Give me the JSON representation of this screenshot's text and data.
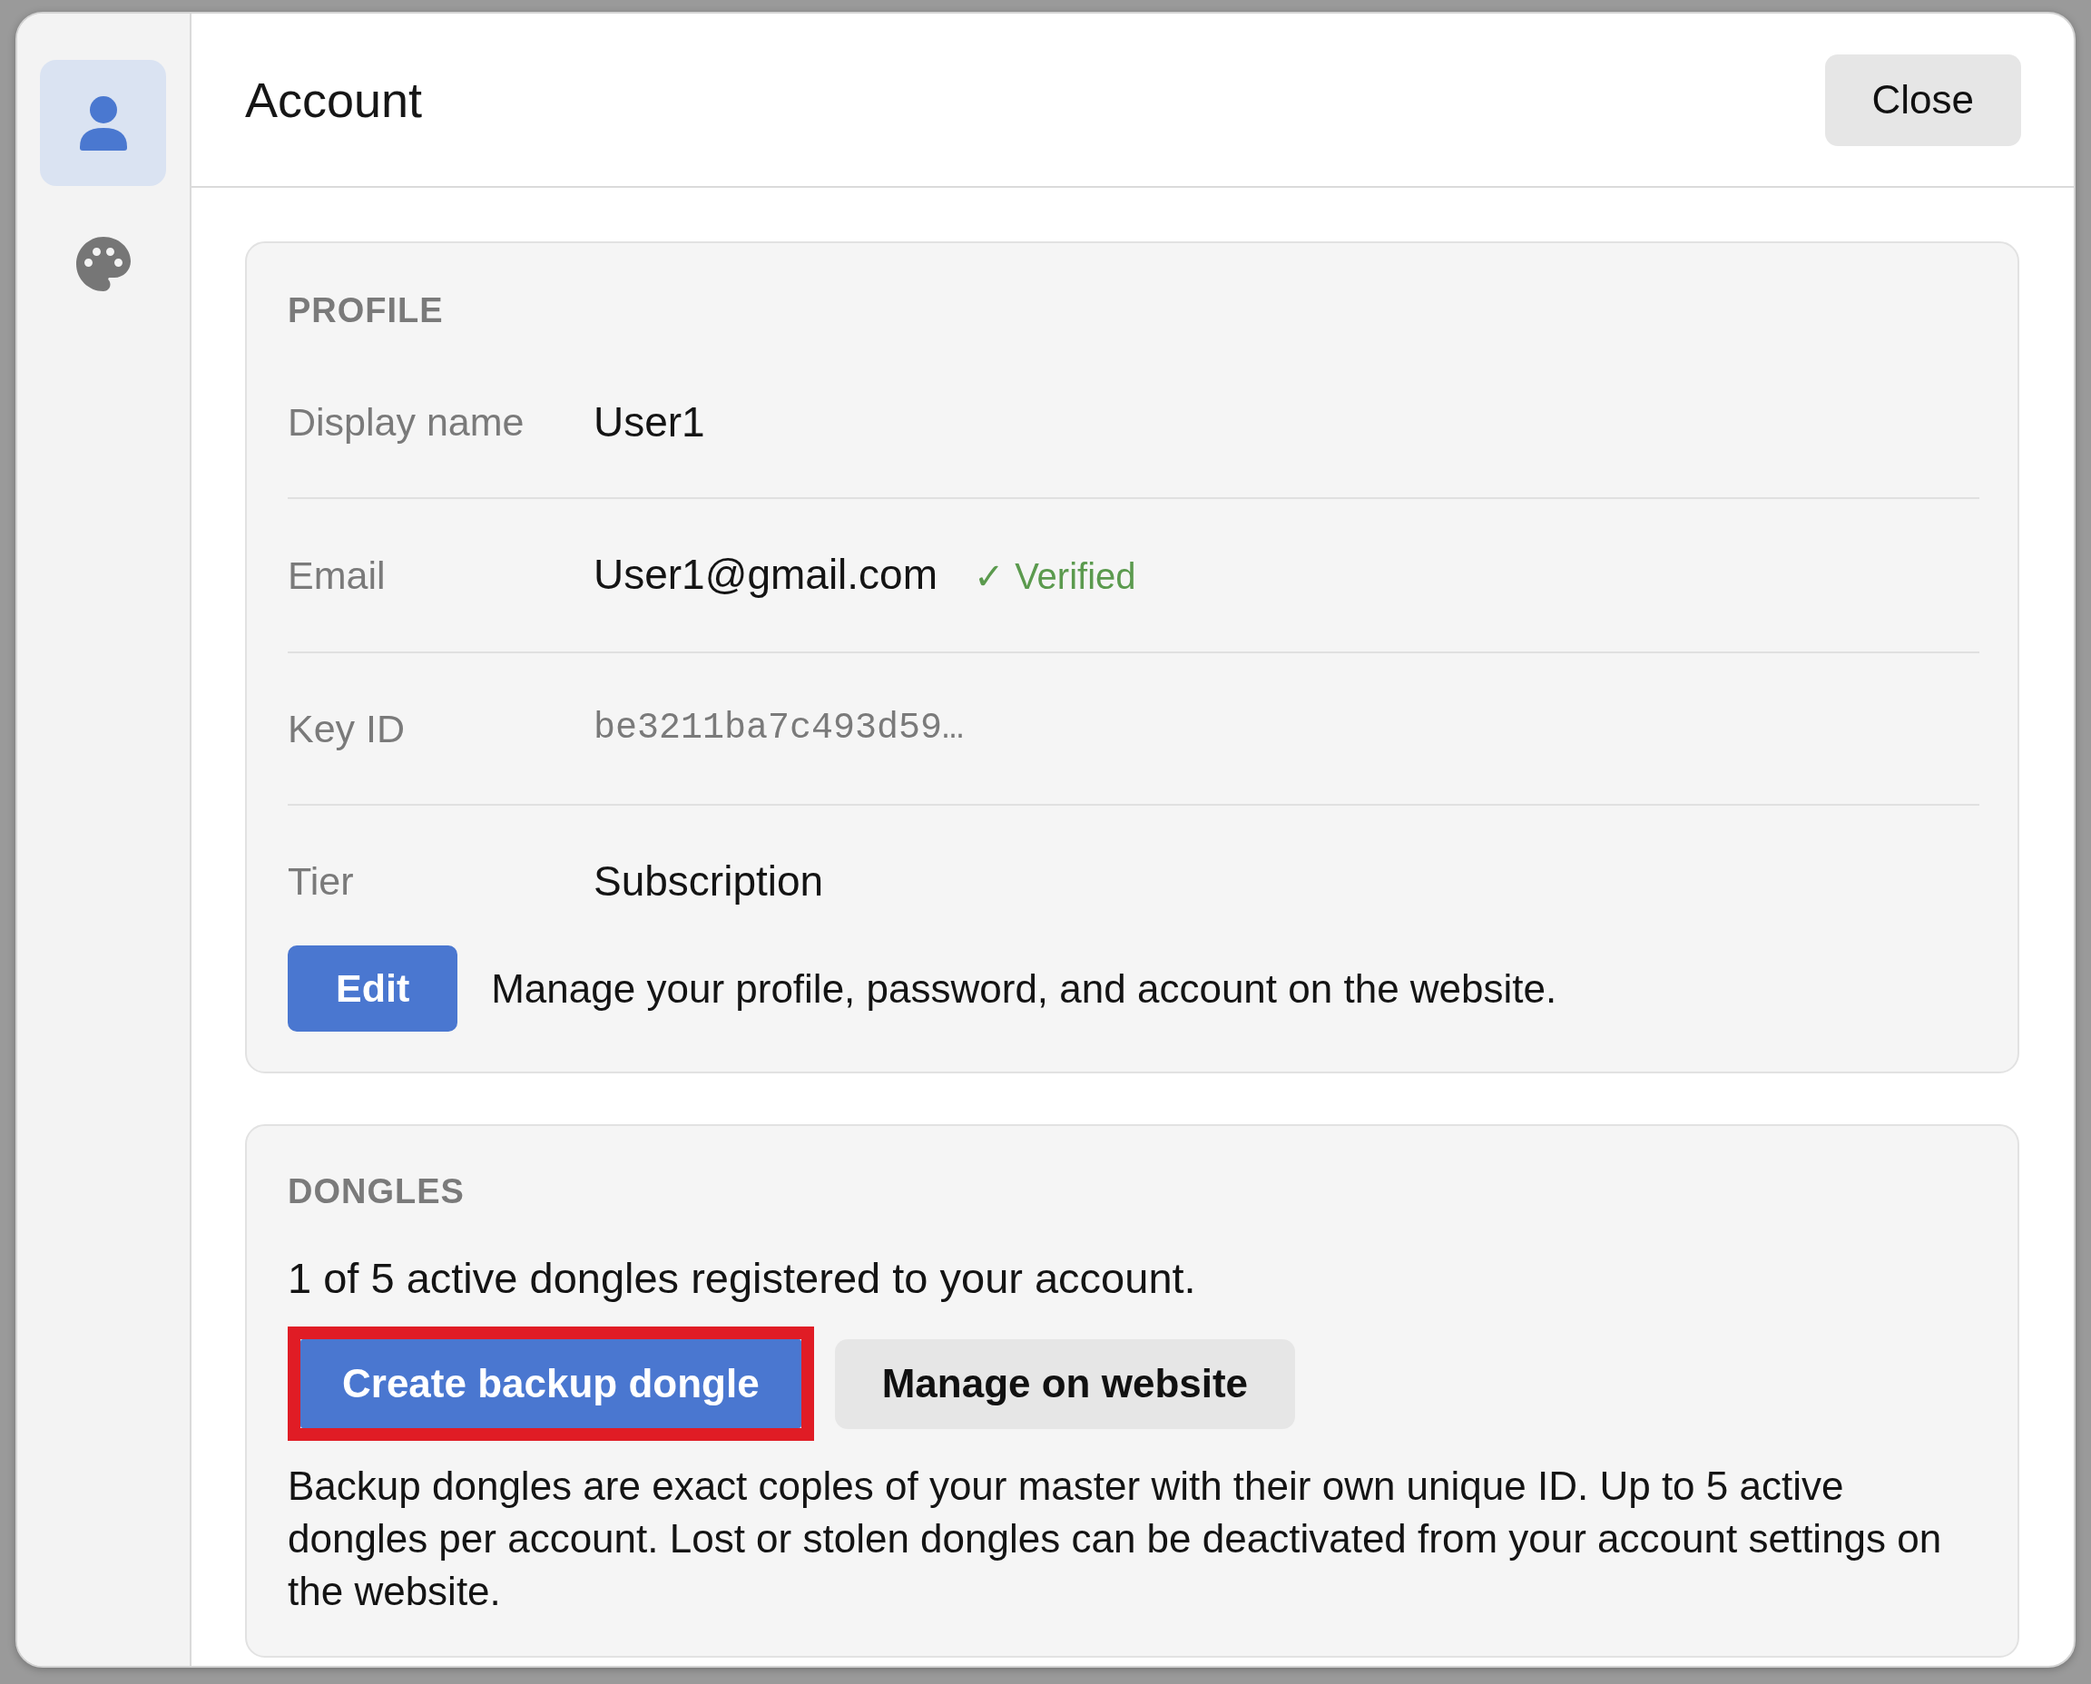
{
  "window": {
    "title": "Account",
    "close_label": "Close"
  },
  "sidebar": {
    "items": [
      {
        "kind": "person",
        "selected": true
      },
      {
        "kind": "palette",
        "selected": false
      }
    ]
  },
  "profile": {
    "heading": "PROFILE",
    "rows": [
      {
        "kind": "text",
        "label": "Display name",
        "value": "User1"
      },
      {
        "kind": "text",
        "label": "Email",
        "value": "User1@gmail.com",
        "status": "✓ Verified"
      },
      {
        "kind": "code",
        "label": "Key ID",
        "value": "be3211ba7c493d59…"
      },
      {
        "kind": "text",
        "label": "Tier",
        "value": "Subscription"
      }
    ],
    "edit_button": "Edit",
    "edit_description": "Manage your profile, password, and account on the website."
  },
  "dongles": {
    "heading": "DONGLES",
    "summary": "1 of 5 active dongles registered to your account.",
    "buttons": [
      {
        "kind": "primary",
        "label": "Create backup dongle",
        "highlighted": true
      },
      {
        "kind": "secondary",
        "label": "Manage on website",
        "highlighted": false
      }
    ],
    "note": "Backup dongles are exact coples of your master with their own unique ID. Up to 5 active dongles per account. Lost or stolen dongles can be deactivated from your account settings on the website."
  }
}
